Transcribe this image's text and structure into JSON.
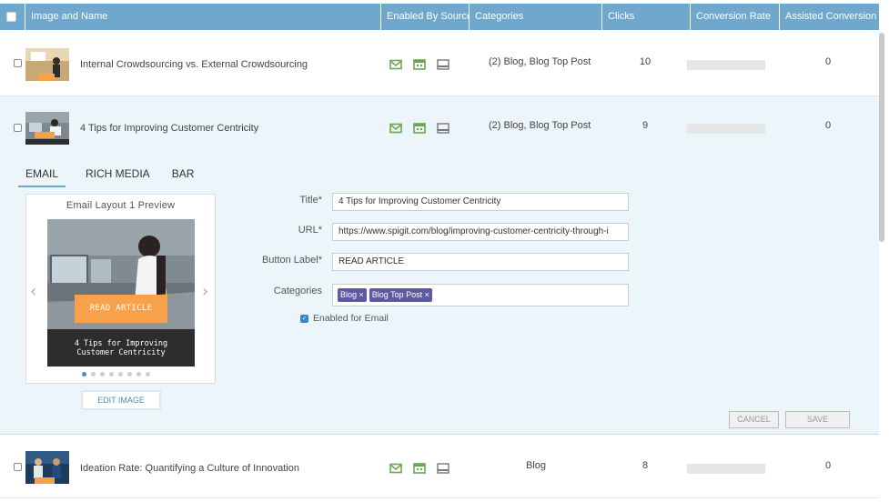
{
  "columns": {
    "image_and_name": "Image and Name",
    "enabled_by_source": "Enabled By Source",
    "categories": "Categories",
    "clicks": "Clicks",
    "conversion_rate": "Conversion Rate",
    "assisted_conversion": "Assisted Conversion"
  },
  "rows": [
    {
      "name": "Internal Crowdsourcing vs. External Crowdsourcing",
      "categories": "(2) Blog, Blog Top Post",
      "clicks": "10",
      "assisted": "0"
    },
    {
      "name": "4 Tips for Improving Customer Centricity",
      "categories": "(2) Blog, Blog Top Post",
      "clicks": "9",
      "assisted": "0"
    },
    {
      "name": "Ideation Rate: Quantifying a Culture of Innovation",
      "categories": "Blog",
      "clicks": "8",
      "assisted": "0"
    }
  ],
  "editor": {
    "tabs": [
      "EMAIL",
      "RICH MEDIA",
      "BAR"
    ],
    "preview_title": "Email Layout 1 Preview",
    "preview_button": "READ ARTICLE",
    "preview_caption_line1": "4 Tips for Improving",
    "preview_caption_line2": "Customer Centricity",
    "edit_image": "EDIT IMAGE",
    "fields": {
      "title_label": "Title*",
      "title_value": "4 Tips for Improving Customer Centricity",
      "url_label": "URL*",
      "url_value": "https://www.spigit.com/blog/improving-customer-centricity-through-i",
      "button_label": "Button Label*",
      "button_value": "READ ARTICLE",
      "categories_label": "Categories",
      "category_tags": [
        "Blog ×",
        "Blog Top Post ×"
      ],
      "enabled_label": "Enabled for Email"
    },
    "cancel": "CANCEL",
    "save": "SAVE"
  },
  "colors": {
    "header": "#70a8cd",
    "expanded_bg": "#ecf5f9",
    "source_icon": "#6aa84f",
    "tag": "#5b5ba3",
    "cta": "#f7a24a"
  }
}
